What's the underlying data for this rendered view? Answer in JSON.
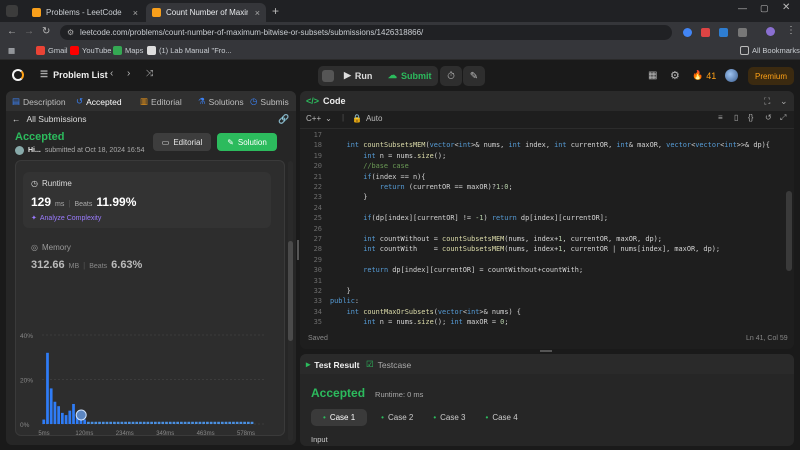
{
  "browser": {
    "tabs": [
      {
        "title": "Problems - LeetCode"
      },
      {
        "title": "Count Number of Maximum Bi"
      }
    ],
    "url": "leetcode.com/problems/count-number-of-maximum-bitwise-or-subsets/submissions/1426318866/",
    "bookmarks": [
      "Gmail",
      "YouTube",
      "Maps",
      "(1) Lab Manual \"Fro..."
    ],
    "all_bookmarks": "All Bookmarks"
  },
  "nav": {
    "problem_list": "Problem List",
    "run": "Run",
    "submit": "Submit",
    "streak": "41",
    "premium": "Premium"
  },
  "left": {
    "tabs": [
      "Description",
      "Accepted",
      "Editorial",
      "Solutions",
      "Submis"
    ],
    "back": "All Submissions",
    "status": "Accepted",
    "user": "Hi...",
    "submitted": "submitted at Oct 18, 2024 16:54",
    "editorial_btn": "Editorial",
    "solution_btn": "Solution",
    "runtime": {
      "label": "Runtime",
      "value": "129",
      "unit": "ms",
      "beats_label": "Beats",
      "beats": "11.99%",
      "analyze": "Analyze Complexity"
    },
    "memory": {
      "label": "Memory",
      "value": "312.66",
      "unit": "MB",
      "beats_label": "Beats",
      "beats": "6.63%"
    }
  },
  "chart_data": {
    "type": "bar",
    "yticks": [
      "40%",
      "20%",
      "0%"
    ],
    "ylim": [
      0,
      40
    ],
    "xticks": [
      "5ms",
      "120ms",
      "234ms",
      "349ms",
      "463ms",
      "578ms"
    ],
    "values": [
      2,
      32,
      16,
      10,
      8,
      5,
      4,
      6,
      9,
      4,
      3,
      2,
      1,
      1,
      1,
      1,
      1,
      1,
      1,
      1,
      1,
      1,
      1,
      1,
      1,
      1,
      1,
      1,
      1,
      1,
      1,
      1,
      1,
      1,
      1,
      1,
      1,
      1,
      1,
      1,
      1,
      1,
      1,
      1,
      1,
      1,
      1,
      1,
      1,
      1,
      1,
      1,
      1,
      1,
      1,
      1,
      1
    ],
    "colors": {
      "bar": "#2f7cf6",
      "bar_light": "#4a90e2"
    },
    "user_bar_index": 11
  },
  "code": {
    "title": "Code",
    "language": "C++",
    "mode": "Auto",
    "first_line": 17,
    "lines": [
      "",
      "    int countSubsetsMEM(vector<int>& nums, int index, int currentOR, int& maxOR, vector<vector<int>>& dp){",
      "        int n = nums.size();",
      "        //base case",
      "        if(index == n){",
      "            return (currentOR == maxOR)?1:0;",
      "        }",
      "",
      "        if(dp[index][currentOR] != -1) return dp[index][currentOR];",
      "",
      "        int countWithout = countSubsetsMEM(nums, index+1, currentOR, maxOR, dp);",
      "        int countWith    = countSubsetsMEM(nums, index+1, currentOR | nums[index], maxOR, dp);",
      "",
      "        return dp[index][currentOR] = countWithout+countWith;",
      "",
      "    }",
      "public:",
      "    int countMaxOrSubsets(vector<int>& nums) {",
      "        int n = nums.size(); int maxOR = 0;"
    ],
    "saved": "Saved",
    "cursor": "Ln 41, Col 59"
  },
  "result": {
    "tab_result": "Test Result",
    "tab_testcase": "Testcase",
    "status": "Accepted",
    "runtime": "Runtime: 0 ms",
    "cases": [
      "Case 1",
      "Case 2",
      "Case 3",
      "Case 4"
    ],
    "input_label": "Input"
  }
}
